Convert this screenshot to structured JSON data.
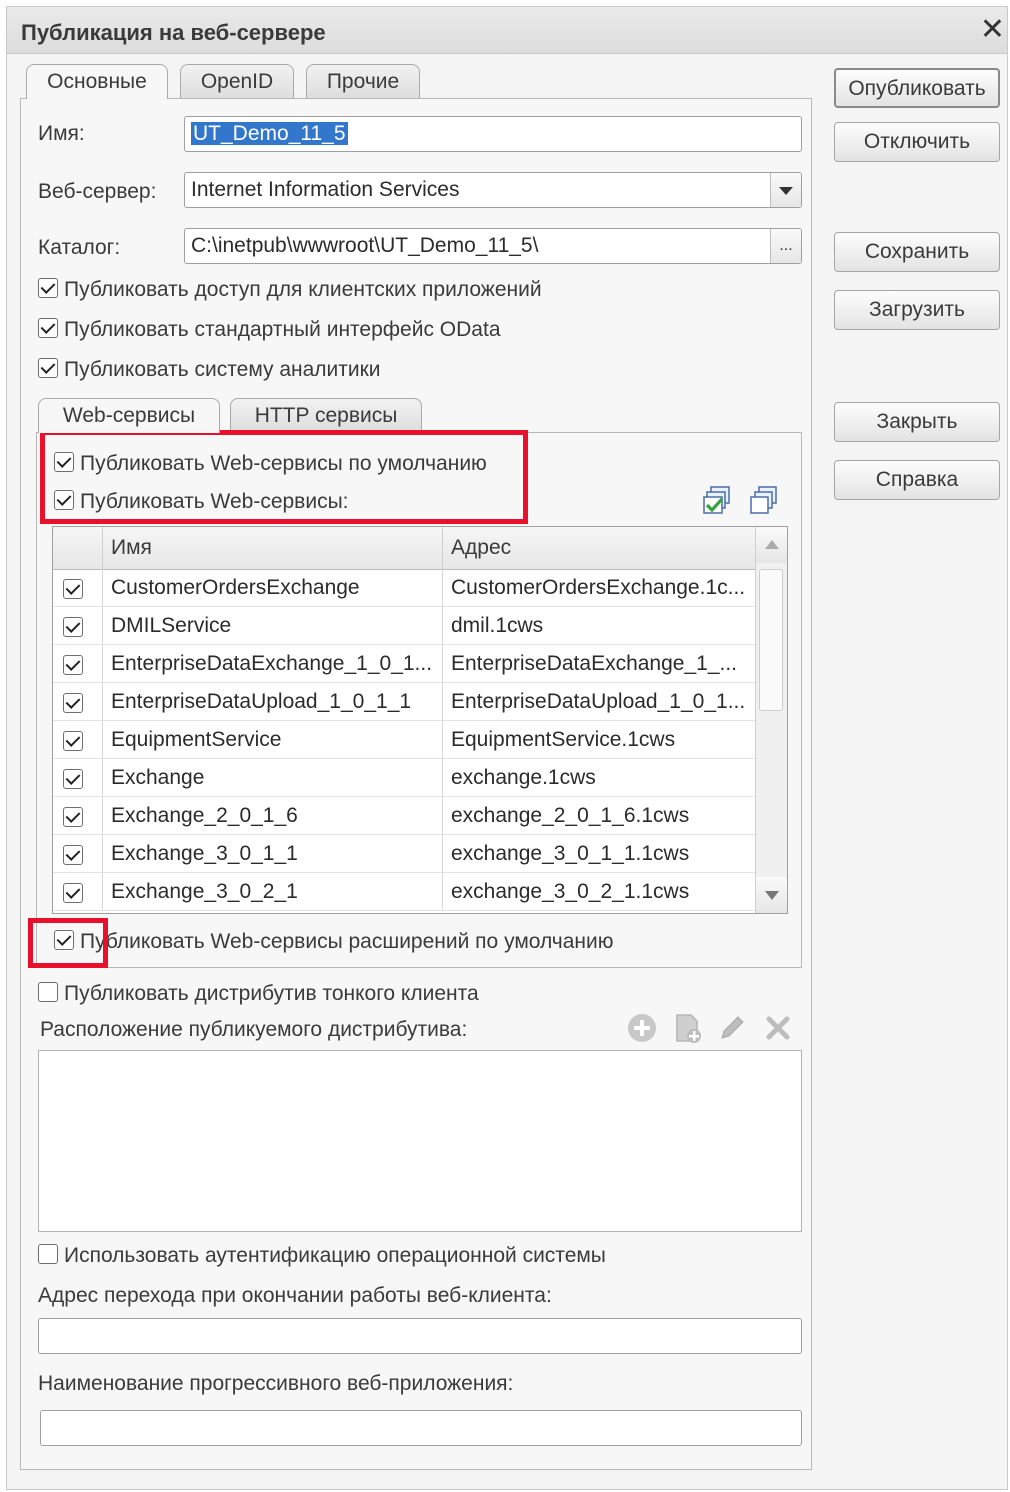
{
  "window": {
    "title": "Публикация на веб-сервере",
    "close_glyph": "✕"
  },
  "tabs": [
    {
      "label": "Основные",
      "active": true
    },
    {
      "label": "OpenID",
      "active": false
    },
    {
      "label": "Прочие",
      "active": false
    }
  ],
  "fields": {
    "name_label": "Имя:",
    "name_value": "UT_Demo_11_5",
    "webserver_label": "Веб-сервер:",
    "webserver_value": "Internet Information Services",
    "catalog_label": "Каталог:",
    "catalog_value": "C:\\inetpub\\wwwroot\\UT_Demo_11_5\\",
    "catalog_button": "..."
  },
  "main_checkboxes": [
    {
      "label": "Публиковать доступ для клиентских приложений",
      "checked": true
    },
    {
      "label": "Публиковать стандартный интерфейс OData",
      "checked": true
    },
    {
      "label": "Публиковать систему аналитики",
      "checked": true
    }
  ],
  "inner_tabs": [
    {
      "label": "Web-сервисы",
      "active": true
    },
    {
      "label": "HTTP сервисы",
      "active": false
    }
  ],
  "web_services": {
    "publish_default_label": "Публиковать Web-сервисы по умолчанию",
    "publish_default_checked": true,
    "publish_label": "Публиковать Web-сервисы:",
    "publish_checked": true,
    "icons": [
      "check-all-icon",
      "uncheck-all-icon"
    ],
    "columns": [
      "Имя",
      "Адрес"
    ],
    "rows": [
      {
        "checked": true,
        "name": "CustomerOrdersExchange",
        "address": "CustomerOrdersExchange.1c..."
      },
      {
        "checked": true,
        "name": "DMILService",
        "address": "dmil.1cws"
      },
      {
        "checked": true,
        "name": "EnterpriseDataExchange_1_0_1...",
        "address": "EnterpriseDataExchange_1_..."
      },
      {
        "checked": true,
        "name": "EnterpriseDataUpload_1_0_1_1",
        "address": "EnterpriseDataUpload_1_0_1..."
      },
      {
        "checked": true,
        "name": "EquipmentService",
        "address": "EquipmentService.1cws"
      },
      {
        "checked": true,
        "name": "Exchange",
        "address": "exchange.1cws"
      },
      {
        "checked": true,
        "name": "Exchange_2_0_1_6",
        "address": "exchange_2_0_1_6.1cws"
      },
      {
        "checked": true,
        "name": "Exchange_3_0_1_1",
        "address": "exchange_3_0_1_1.1cws"
      },
      {
        "checked": true,
        "name": "Exchange_3_0_2_1",
        "address": "exchange_3_0_2_1.1cws"
      }
    ],
    "extensions_default_label": "Публиковать Web-сервисы расширений по умолчанию",
    "extensions_default_checked": true
  },
  "distributive": {
    "publish_label": "Публиковать дистрибутив тонкого клиента",
    "publish_checked": false,
    "location_label": "Расположение публикуемого дистрибутива:",
    "icons": [
      "add-icon",
      "copy-icon",
      "edit-icon",
      "delete-icon"
    ]
  },
  "os_auth": {
    "label": "Использовать аутентификацию операционной системы",
    "checked": false
  },
  "exit_address": {
    "label": "Адрес перехода при окончании работы веб-клиента:",
    "value": ""
  },
  "pwa_name": {
    "label": "Наименование прогрессивного веб-приложения:",
    "value": ""
  },
  "buttons": {
    "publish": "Опубликовать",
    "disable": "Отключить",
    "save": "Сохранить",
    "load": "Загрузить",
    "close": "Закрыть",
    "help": "Справка"
  },
  "colors": {
    "highlight": "#e8102a",
    "selection": "#3377cc",
    "icon_green": "#3aa23a",
    "icon_gray": "#b5b5b5"
  }
}
